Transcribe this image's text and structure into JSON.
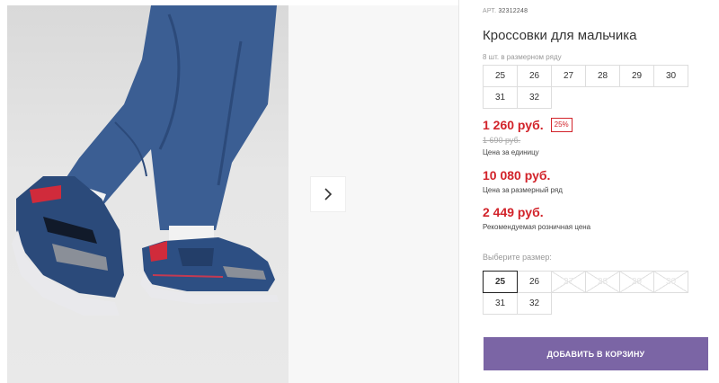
{
  "product": {
    "sku_label": "АРТ.",
    "sku_value": "32312248",
    "title": "Кроссовки для мальчика",
    "pack_text": "8 шт. в размерном ряду",
    "pack_sizes": [
      "25",
      "26",
      "27",
      "28",
      "29",
      "30",
      "31",
      "32"
    ],
    "price": "1 260 руб.",
    "discount": "25%",
    "old_price": "1 690 руб.",
    "unit_caption": "Цена за единицу",
    "pack_price": "10 080 руб.",
    "pack_caption": "Цена за размерный ряд",
    "retail_price": "2 449 руб.",
    "retail_caption": "Рекомендуемая розничная цена"
  },
  "size_picker": {
    "label": "Выберите размер:",
    "sizes": [
      {
        "label": "25",
        "state": "selected"
      },
      {
        "label": "26",
        "state": "available"
      },
      {
        "label": "27",
        "state": "unavailable"
      },
      {
        "label": "28",
        "state": "unavailable"
      },
      {
        "label": "29",
        "state": "unavailable"
      },
      {
        "label": "30",
        "state": "unavailable"
      },
      {
        "label": "31",
        "state": "available"
      },
      {
        "label": "32",
        "state": "available"
      }
    ]
  },
  "actions": {
    "add_to_cart": "ДОБАВИТЬ В КОРЗИНУ"
  },
  "icons": {
    "next": "chevron-right-icon"
  },
  "colors": {
    "accent_button": "#7b65a5",
    "price_red": "#d2232a"
  }
}
